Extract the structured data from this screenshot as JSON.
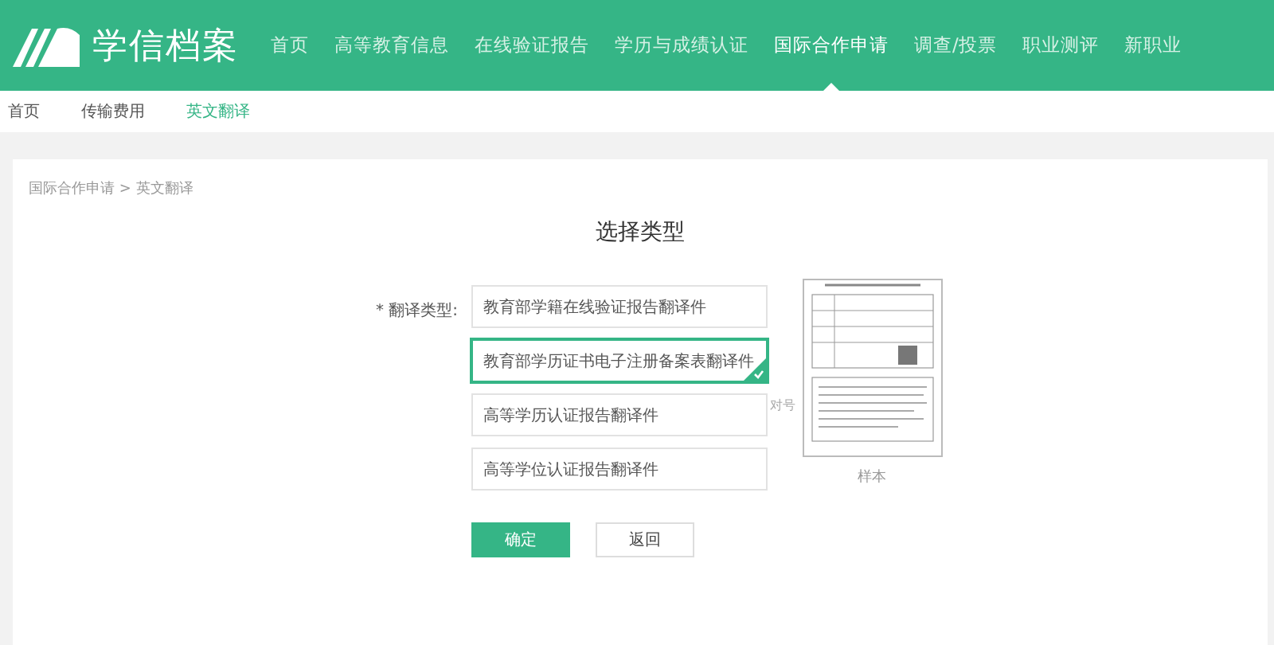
{
  "header": {
    "logo_text": "学信档案",
    "nav": [
      {
        "label": "首页",
        "selected": false
      },
      {
        "label": "高等教育信息",
        "selected": false
      },
      {
        "label": "在线验证报告",
        "selected": false
      },
      {
        "label": "学历与成绩认证",
        "selected": false
      },
      {
        "label": "国际合作申请",
        "selected": true
      },
      {
        "label": "调查/投票",
        "selected": false
      },
      {
        "label": "职业测评",
        "selected": false
      },
      {
        "label": "新职业",
        "selected": false
      }
    ]
  },
  "subnav": [
    {
      "label": "首页",
      "selected": false
    },
    {
      "label": "传输费用",
      "selected": false
    },
    {
      "label": "英文翻译",
      "selected": true
    }
  ],
  "breadcrumb": "国际合作申请 > 英文翻译",
  "title": "选择类型",
  "form": {
    "label": "翻译类型:",
    "required_mark": "*",
    "options": [
      {
        "label": "教育部学籍在线验证报告翻译件",
        "selected": false
      },
      {
        "label": "教育部学历证书电子注册备案表翻译件",
        "selected": true
      },
      {
        "label": "高等学历认证报告翻译件",
        "selected": false
      },
      {
        "label": "高等学位认证报告翻译件",
        "selected": false
      }
    ],
    "hint": "对号",
    "sample_caption": "样本"
  },
  "buttons": [
    {
      "label": "确定",
      "kind": "primary"
    },
    {
      "label": "返回",
      "kind": "secondary"
    }
  ]
}
